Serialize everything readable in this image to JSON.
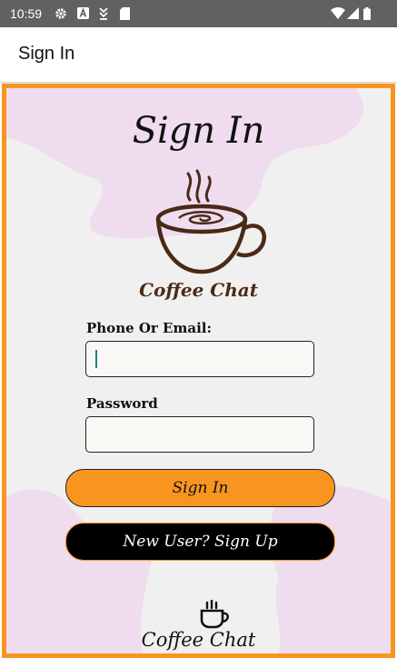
{
  "status_bar": {
    "time": "10:59",
    "icons": [
      "settings-gear-icon",
      "a-notification-icon",
      "download-icon",
      "sd-card-icon",
      "wifi-icon",
      "cellular-signal-icon",
      "battery-icon"
    ]
  },
  "app_bar": {
    "title": "Sign In"
  },
  "form": {
    "heading": "Sign In",
    "logo_text": "Coffee Chat",
    "phone_email_label": "Phone Or Email:",
    "phone_email_value": "",
    "password_label": "Password",
    "password_value": "",
    "sign_in_button": "Sign In",
    "sign_up_button": "New User? Sign Up"
  },
  "footer": {
    "logo_text": "Coffee Chat"
  },
  "colors": {
    "accent_orange": "#f89520",
    "panel_background": "#f1f0f0",
    "blob_pink": "#efdcef",
    "coffee_brown": "#4a2a17",
    "status_bar": "#616161"
  }
}
